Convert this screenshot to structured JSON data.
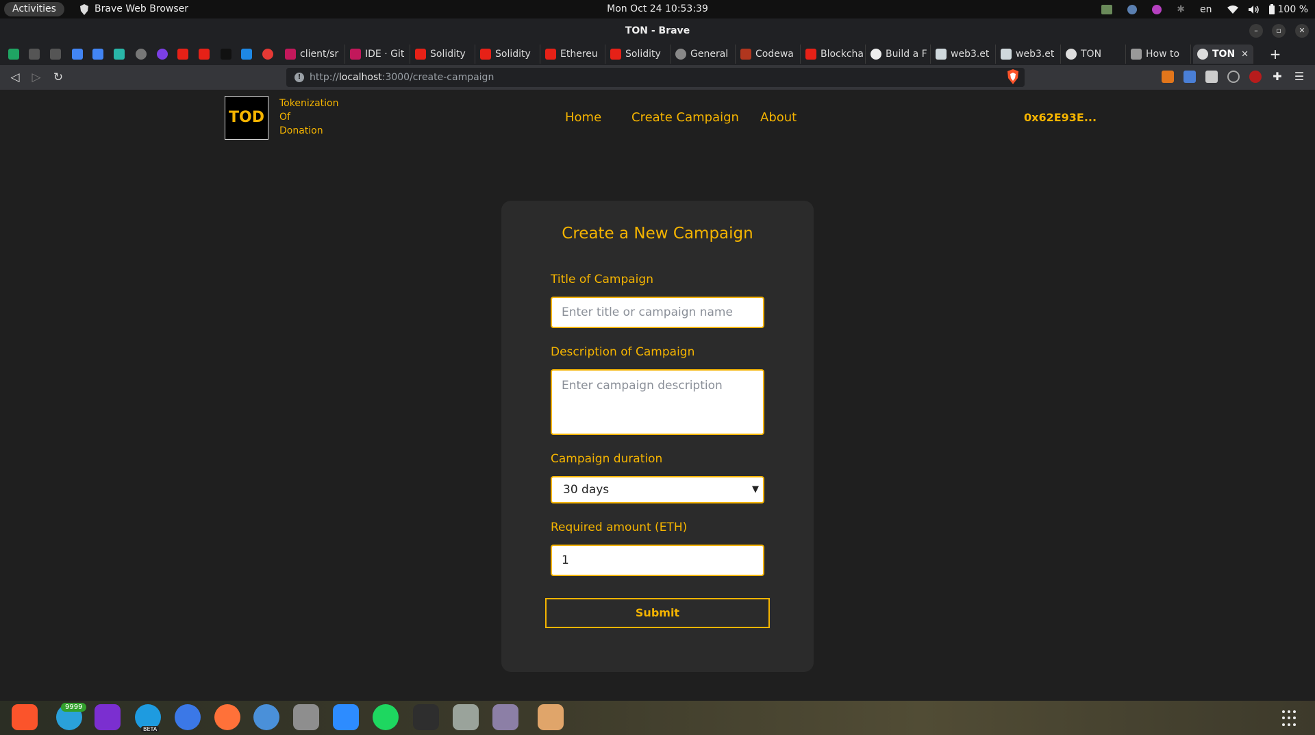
{
  "system_bar": {
    "activities": "Activities",
    "app_name": "Brave Web Browser",
    "clock": "Mon Oct 24  10:53:39",
    "language": "en",
    "battery": "100 %"
  },
  "window": {
    "title": "TON - Brave"
  },
  "tabs": [
    {
      "label": "client/sr",
      "icon": "nix-icon"
    },
    {
      "label": "IDE · Git",
      "icon": "nix-icon"
    },
    {
      "label": "Solidity",
      "icon": "youtube-icon"
    },
    {
      "label": "Solidity",
      "icon": "youtube-icon"
    },
    {
      "label": "Ethereu",
      "icon": "youtube-icon"
    },
    {
      "label": "Solidity",
      "icon": "youtube-icon"
    },
    {
      "label": "General",
      "icon": "globe-icon"
    },
    {
      "label": "Codewa",
      "icon": "codewars-icon"
    },
    {
      "label": "Blockcha",
      "icon": "youtube-icon"
    },
    {
      "label": "Build a F",
      "icon": "medium-icon"
    },
    {
      "label": "web3.et",
      "icon": "doc-icon"
    },
    {
      "label": "web3.et",
      "icon": "doc-icon"
    },
    {
      "label": "TON",
      "icon": "globe-icon"
    },
    {
      "label": "How to",
      "icon": "cube-icon"
    }
  ],
  "active_tab": {
    "label": "TON",
    "close": "✕"
  },
  "address_bar": {
    "url_prefix": "http://",
    "url_host": "localhost",
    "url_rest": ":3000/create-campaign"
  },
  "site": {
    "logo": "TOD",
    "logo_lines": [
      "Tokenization",
      "Of",
      "Donation"
    ],
    "nav": [
      "Home",
      "Create Campaign",
      "About"
    ],
    "wallet": "0x62E93E..."
  },
  "form": {
    "title": "Create a New Campaign",
    "title_label": "Title of Campaign",
    "title_placeholder": "Enter title or campaign name",
    "description_label": "Description of Campaign",
    "description_placeholder": "Enter campaign description",
    "duration_label": "Campaign duration",
    "duration_value": "30 days",
    "amount_label": "Required amount (ETH)",
    "amount_value": "1",
    "submit": "Submit"
  },
  "dock": {
    "telegram_badge": "9999",
    "edge_label": "BETA"
  },
  "colors": {
    "accent": "#f5b400",
    "page_bg": "#1f1f1f",
    "card_bg": "#2b2b2b"
  }
}
